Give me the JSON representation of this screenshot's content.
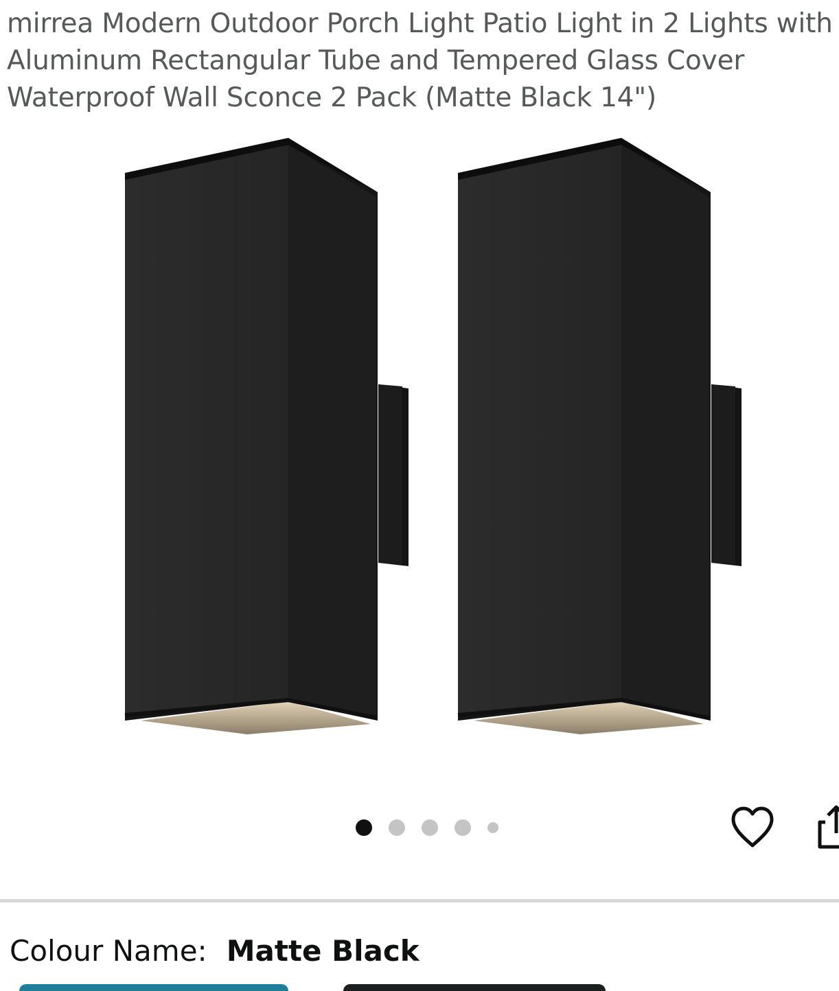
{
  "product": {
    "title_lines": [
      "mirrea Modern Outdoor Porch Light Patio Light in 2 Lights with",
      "Aluminum Rectangular Tube and Tempered Glass Cover",
      "Waterproof Wall Sconce 2 Pack (Matte Black 14\")"
    ]
  },
  "gallery": {
    "image_subject": "two-matte-black-rectangular-wall-sconces",
    "dot_count": 5,
    "active_index": 0
  },
  "actions": {
    "wishlist_icon": "heart-outline-icon",
    "share_icon": "share-icon"
  },
  "variation": {
    "label": "Colour Name:",
    "value": "Matte Black"
  },
  "colors": {
    "text_primary": "#0f1111",
    "text_secondary": "#565959",
    "divider": "#d5d9d9",
    "dot_inactive": "#c4c4c4",
    "dot_active": "#0f1111",
    "selected_swatch_border": "#1f7f9a"
  }
}
